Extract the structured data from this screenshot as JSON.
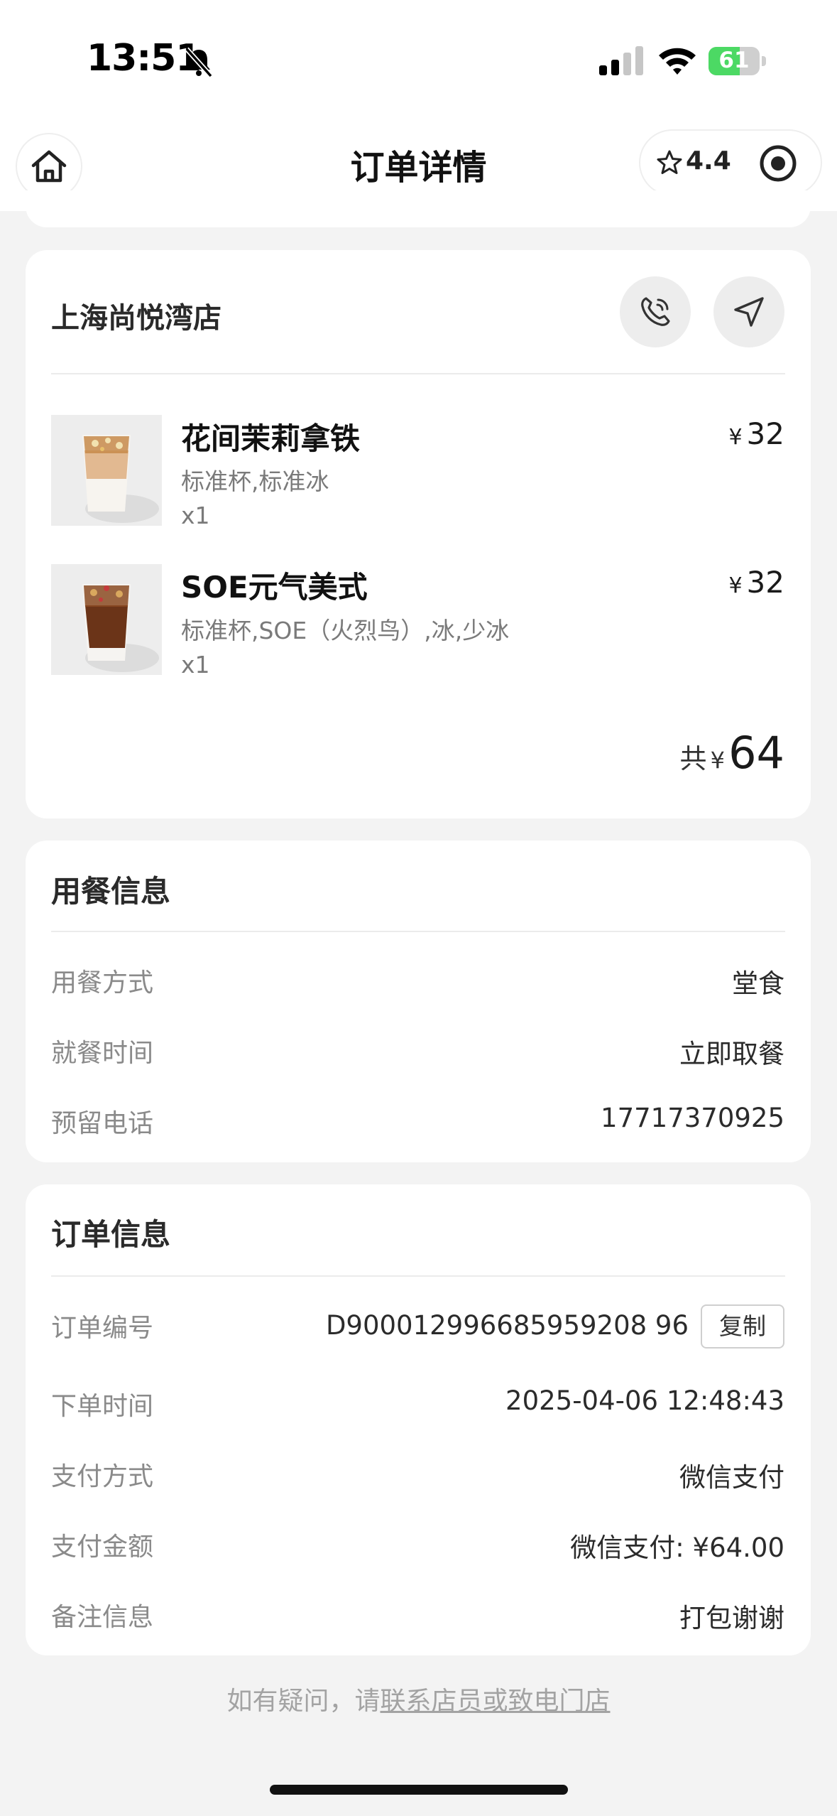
{
  "status_bar": {
    "time": "13:51",
    "battery": "61",
    "battery_level": 0.61
  },
  "nav": {
    "title": "订单详情",
    "rating": "4.4"
  },
  "store": {
    "name": "上海尚悦湾店",
    "items": [
      {
        "name": "花间茉莉拿铁",
        "spec": "标准杯,标准冰",
        "qty": "x1",
        "currency": "¥",
        "price": "32"
      },
      {
        "name": "SOE元气美式",
        "spec": "标准杯,SOE（火烈鸟）,冰,少冰",
        "qty": "x1",
        "currency": "¥",
        "price": "32"
      }
    ],
    "total_label": "共",
    "total_currency": "¥",
    "total": "64"
  },
  "dining": {
    "title": "用餐信息",
    "rows": [
      {
        "label": "用餐方式",
        "value": "堂食"
      },
      {
        "label": "就餐时间",
        "value": "立即取餐"
      },
      {
        "label": "预留电话",
        "value": "17717370925"
      }
    ]
  },
  "order": {
    "title": "订单信息",
    "copy_label": "复制",
    "rows": [
      {
        "label": "订单编号",
        "value": "D900012996685959208 96"
      },
      {
        "label": "下单时间",
        "value": "2025-04-06 12:48:43"
      },
      {
        "label": "支付方式",
        "value": "微信支付"
      },
      {
        "label": "支付金额",
        "value": "微信支付: ¥64.00"
      },
      {
        "label": "备注信息",
        "value": "打包谢谢"
      }
    ]
  },
  "footer": {
    "prefix": "如有疑问，请",
    "link": "联系店员或致电门店"
  },
  "colors": {
    "accent_green": "#4cd964",
    "background": "#f3f3f3",
    "card": "#ffffff"
  }
}
